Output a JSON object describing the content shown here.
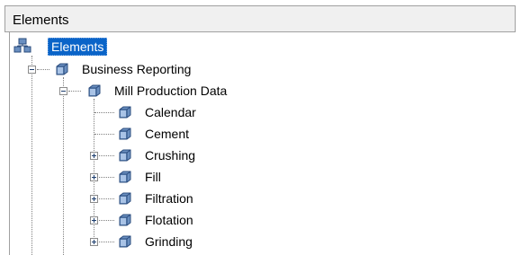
{
  "panel": {
    "title": "Elements"
  },
  "tree": {
    "root": {
      "label": "Elements",
      "icon": "elements-root-icon"
    },
    "business_reporting": {
      "label": "Business Reporting",
      "expanded": true,
      "icon": "cube-icon"
    },
    "mill_production_data": {
      "label": "Mill Production Data",
      "expanded": true,
      "icon": "cube-icon"
    },
    "children": [
      {
        "label": "Calendar",
        "has_children": false
      },
      {
        "label": "Cement",
        "has_children": false
      },
      {
        "label": "Crushing",
        "has_children": true
      },
      {
        "label": "Fill",
        "has_children": true
      },
      {
        "label": "Filtration",
        "has_children": true
      },
      {
        "label": "Flotation",
        "has_children": true
      },
      {
        "label": "Grinding",
        "has_children": true
      }
    ]
  },
  "colors": {
    "selection": "#0a64c8",
    "cube": "#6a8fc0",
    "tree_lines": "#808080"
  }
}
